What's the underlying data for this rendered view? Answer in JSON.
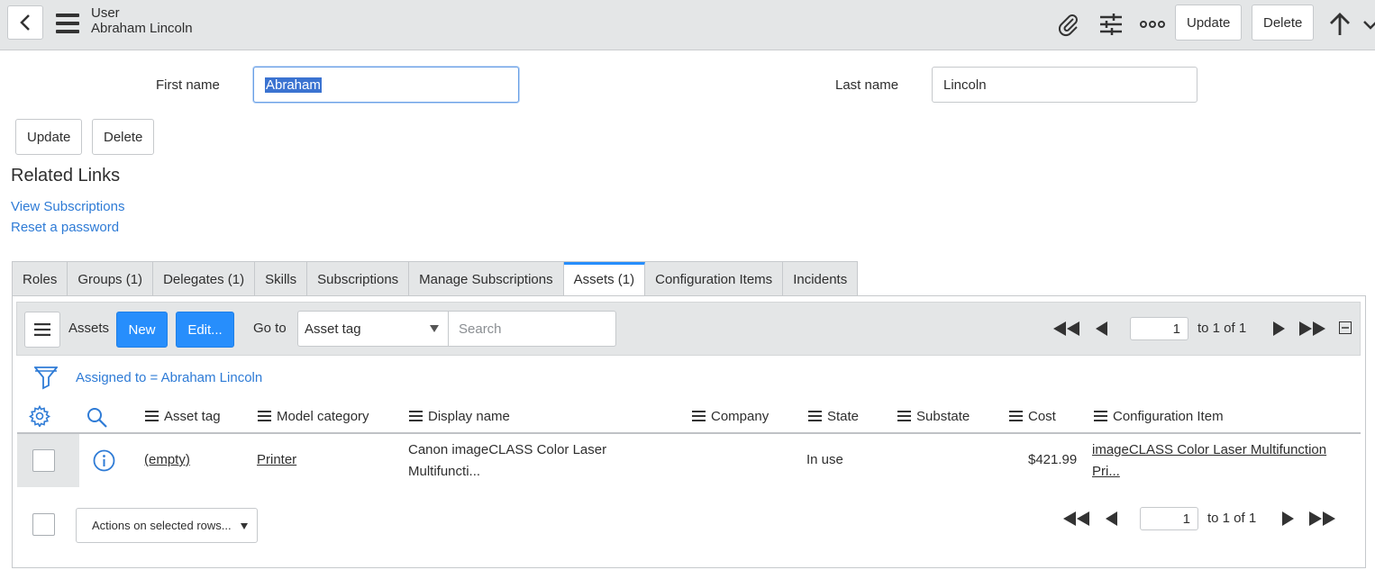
{
  "header": {
    "record_type": "User",
    "record_name": "Abraham Lincoln",
    "update_label": "Update",
    "delete_label": "Delete"
  },
  "form": {
    "first_name_label": "First name",
    "first_name_value": "Abraham",
    "last_name_label": "Last name",
    "last_name_value": "Lincoln",
    "update_label": "Update",
    "delete_label": "Delete"
  },
  "related_links": {
    "title": "Related Links",
    "items": [
      "View Subscriptions",
      "Reset a password"
    ]
  },
  "tabs": [
    {
      "label": "Roles",
      "active": false
    },
    {
      "label": "Groups (1)",
      "active": false
    },
    {
      "label": "Delegates (1)",
      "active": false
    },
    {
      "label": "Skills",
      "active": false
    },
    {
      "label": "Subscriptions",
      "active": false
    },
    {
      "label": "Manage Subscriptions",
      "active": false
    },
    {
      "label": "Assets (1)",
      "active": true
    },
    {
      "label": "Configuration Items",
      "active": false
    },
    {
      "label": "Incidents",
      "active": false
    }
  ],
  "list": {
    "title": "Assets",
    "new_label": "New",
    "edit_label": "Edit...",
    "goto_label": "Go to",
    "goto_field": "Asset tag",
    "search_placeholder": "Search",
    "page_value": "1",
    "page_of": "to 1 of 1",
    "filter": "Assigned to = Abraham Lincoln",
    "columns": [
      "Asset tag",
      "Model category",
      "Display name",
      "Company",
      "State",
      "Substate",
      "Cost",
      "Configuration Item"
    ],
    "rows": [
      {
        "asset_tag": "(empty)",
        "model_category": "Printer",
        "display_name_line1": "Canon imageCLASS Color Laser",
        "display_name_line2": "Multifuncti...",
        "company": "",
        "state": "In use",
        "substate": "",
        "cost": "$421.99",
        "ci_line1": "imageCLASS Color Laser Multifunction",
        "ci_line2": "Pri..."
      }
    ],
    "actions_label": "Actions on selected rows...",
    "footer_page_value": "1",
    "footer_page_of": "to 1 of 1"
  },
  "colors": {
    "accent": "#278efc",
    "link": "#2e7bd6",
    "header_bg": "#e4e6e7"
  }
}
